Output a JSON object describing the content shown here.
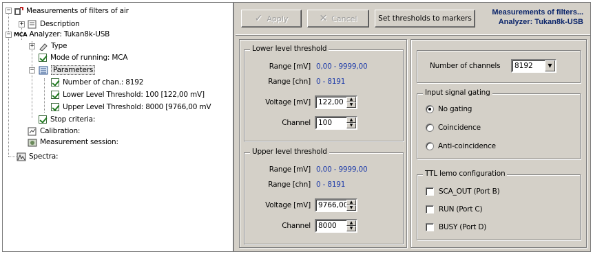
{
  "tree": {
    "root": "Measurements of filters of air",
    "description": "Description",
    "analyzer": "Analyzer: Tukan8k-USB",
    "analyzer_icon_text": "MCA",
    "type": "Type",
    "mode": "Mode of running: MCA",
    "parameters": "Parameters",
    "params": [
      "Number of chan.: 8192",
      "Lower Level Threshold: 100  [122,00 mV]",
      "Upper Level Threshold: 8000  [9766,00 mV"
    ],
    "stop": "Stop criteria:",
    "calibration": "Calibration:",
    "session": "Measurement session:",
    "spectra": "Spectra:"
  },
  "toolbar": {
    "apply": "Apply",
    "cancel": "Cancel",
    "set_thresholds": "Set thresholds to markers",
    "title_line1": "Measurements of filters...",
    "title_line2": "Analyzer: Tukan8k-USB"
  },
  "lower": {
    "title": "Lower level threshold",
    "range_mv_label": "Range [mV]",
    "range_mv": "0,00 - 9999,00",
    "range_chn_label": "Range [chn]",
    "range_chn": "0 - 8191",
    "voltage_label": "Voltage [mV]",
    "voltage": "122,00",
    "channel_label": "Channel",
    "channel": "100"
  },
  "upper": {
    "title": "Upper level threshold",
    "range_mv_label": "Range [mV]",
    "range_mv": "0,00 - 9999,00",
    "range_chn_label": "Range [chn]",
    "range_chn": "0 - 8191",
    "voltage_label": "Voltage [mV]",
    "voltage": "9766,00",
    "channel_label": "Channel",
    "channel": "8000"
  },
  "channels": {
    "label": "Number of channels",
    "value": "8192"
  },
  "gating": {
    "title": "Input signal gating",
    "options": [
      "No gating",
      "Coincidence",
      "Anti-coincidence"
    ],
    "selected": "No gating"
  },
  "ttl": {
    "title": "TTL lemo configuration",
    "options": [
      "SCA_OUT (Port B)",
      "RUN (Port C)",
      "BUSY (Port D)"
    ]
  }
}
